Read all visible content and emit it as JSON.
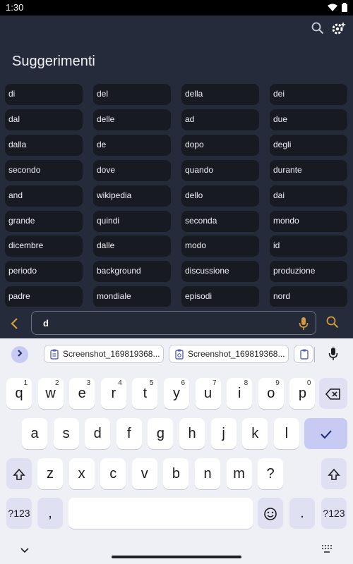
{
  "status_bar": {
    "time": "1:30"
  },
  "page": {
    "title": "Suggerimenti"
  },
  "suggestions": [
    "di",
    "del",
    "della",
    "dei",
    "dal",
    "delle",
    "ad",
    "due",
    "dalla",
    "de",
    "dopo",
    "degli",
    "secondo",
    "dove",
    "quando",
    "durante",
    "and",
    "wikipedia",
    "dello",
    "dai",
    "grande",
    "quindi",
    "seconda",
    "mondo",
    "dicembre",
    "dalle",
    "modo",
    "id",
    "periodo",
    "background",
    "discussione",
    "produzione",
    "padre",
    "mondiale",
    "episodi",
    "nord"
  ],
  "search": {
    "value": "d"
  },
  "keyboard": {
    "clipboard": [
      "Screenshot_169819368...",
      "Screenshot_169819368...",
      "S"
    ],
    "row1": [
      {
        "label": "q",
        "hint": "1"
      },
      {
        "label": "w",
        "hint": "2"
      },
      {
        "label": "e",
        "hint": "3"
      },
      {
        "label": "r",
        "hint": "4"
      },
      {
        "label": "t",
        "hint": "5"
      },
      {
        "label": "y",
        "hint": "6"
      },
      {
        "label": "u",
        "hint": "7"
      },
      {
        "label": "i",
        "hint": "8"
      },
      {
        "label": "o",
        "hint": "9"
      },
      {
        "label": "p",
        "hint": "0"
      }
    ],
    "row2": [
      "a",
      "s",
      "d",
      "f",
      "g",
      "h",
      "j",
      "k",
      "l"
    ],
    "row3": [
      "z",
      "x",
      "c",
      "v",
      "b",
      "n",
      "m",
      "?"
    ],
    "symbols_label": "?123",
    "comma": ",",
    "period": "."
  },
  "icons": [
    "wifi-icon",
    "battery-icon",
    "search-icon",
    "settings-icon",
    "chevron-left-icon",
    "mic-icon",
    "expand-icon",
    "clipboard-icon",
    "backspace-icon",
    "check-icon",
    "shift-icon",
    "emoji-icon",
    "collapse-keyboard-icon",
    "keyboard-switch-icon"
  ],
  "colors": {
    "background": "#252b3a",
    "chip": "#181a21",
    "accent_orange": "#d49a3b",
    "keyboard_bg": "#eff0f6",
    "key_accent": "#c7cbf3"
  }
}
